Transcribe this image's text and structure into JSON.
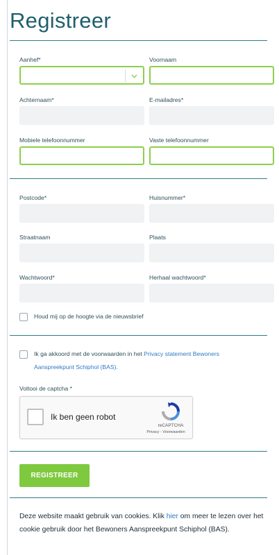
{
  "page": {
    "title": "Registreer"
  },
  "form": {
    "aanhef_label": "Aanhef*",
    "aanhef_value": "",
    "voornaam_label": "Voornaam",
    "voornaam_value": "",
    "achternaam_label": "Achternaam*",
    "achternaam_value": "",
    "email_label": "E-mailadres*",
    "email_value": "",
    "mobiel_label": "Mobiele telefoonnummer",
    "mobiel_value": "",
    "vast_label": "Vaste telefoonnummer",
    "vast_value": "",
    "postcode_label": "Postcode*",
    "postcode_value": "",
    "huisnummer_label": "Huisnummer*",
    "huisnummer_value": "",
    "straatnaam_label": "Straatnaam",
    "straatnaam_value": "",
    "plaats_label": "Plaats",
    "plaats_value": "",
    "wachtwoord_label": "Wachtwoord*",
    "wachtwoord_value": "",
    "herhaal_label": "Herhaal wachtwoord*",
    "herhaal_value": "",
    "newsletter_label": "Houd mij op de hoogte via de nieuwsbrief",
    "newsletter_checked": false,
    "terms_prefix": "Ik ga akkoord met de voorwaarden in het ",
    "terms_link": "Privacy statement Bewoners Aanspreekpunt Schiphol (BAS).",
    "terms_checked": false,
    "captcha_label": "Voltooi de captcha *",
    "submit_label": "REGISTREER"
  },
  "captcha": {
    "checkbox_label": "Ik ben geen robot",
    "brand": "reCAPTCHA",
    "links": "Privacy - Voorwaarden"
  },
  "footer": {
    "cookie_prefix": "Deze website maakt gebruik van cookies. Klik ",
    "cookie_link": "hier",
    "cookie_suffix": " om meer te lezen over het cookie gebruik door het Bewoners Aanspreekpunt Schiphol (BAS)."
  },
  "colors": {
    "title": "#1f5f6c",
    "accent_green": "#7fc93f",
    "field_focus_border": "#8ccf4d",
    "field_bg": "#f0f2f4",
    "link": "#2e7bc4"
  },
  "icons": [
    "chevron-down-icon",
    "recaptcha-logo-icon"
  ]
}
